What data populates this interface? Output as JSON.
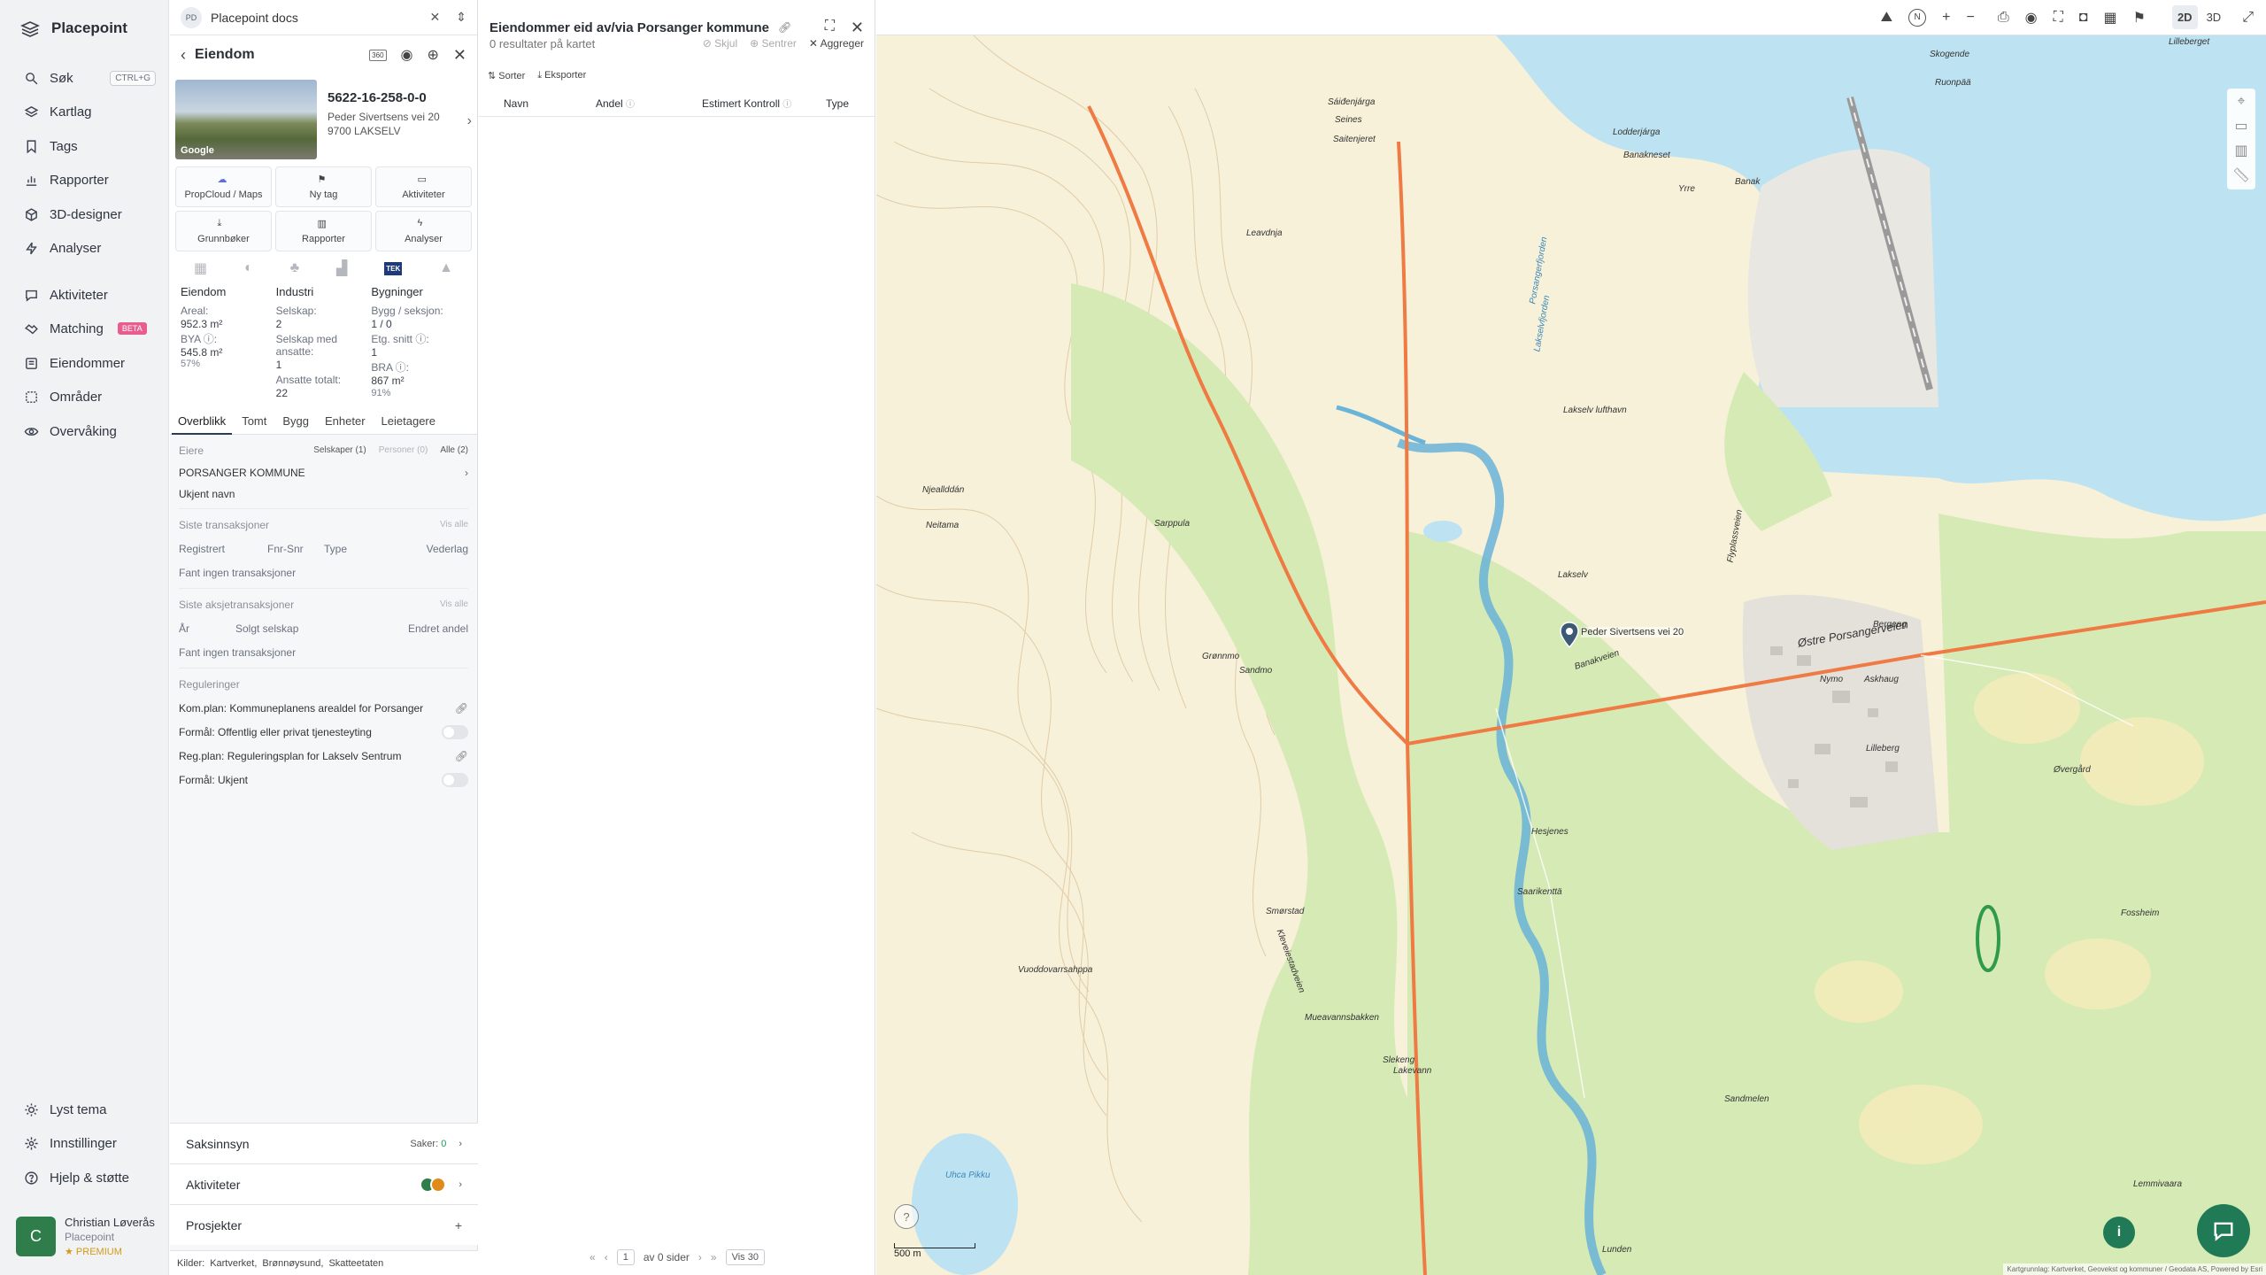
{
  "brand": "Placepoint",
  "nav": [
    {
      "label": "Søk",
      "icon": "search-icon",
      "shortcut": "CTRL+G"
    },
    {
      "label": "Kartlag",
      "icon": "layers-icon"
    },
    {
      "label": "Tags",
      "icon": "bookmark-icon"
    },
    {
      "label": "Rapporter",
      "icon": "bar-chart-icon"
    },
    {
      "label": "3D-designer",
      "icon": "cube-icon"
    },
    {
      "label": "Analyser",
      "icon": "lightning-icon"
    },
    {
      "label": "Aktiviteter",
      "icon": "chat-icon"
    },
    {
      "label": "Matching",
      "icon": "handshake-icon",
      "badge": "BETA"
    },
    {
      "label": "Eiendommer",
      "icon": "list-icon"
    },
    {
      "label": "Områder",
      "icon": "area-icon"
    },
    {
      "label": "Overvåking",
      "icon": "eye-icon"
    }
  ],
  "nav_bottom": [
    {
      "label": "Lyst tema",
      "icon": "sun-icon"
    },
    {
      "label": "Innstillinger",
      "icon": "gear-icon"
    },
    {
      "label": "Hjelp & støtte",
      "icon": "help-icon"
    }
  ],
  "user": {
    "initial": "C",
    "name": "Christian Løverås",
    "org": "Placepoint",
    "plan": "PREMIUM"
  },
  "docs": {
    "badge": "PD",
    "title": "Placepoint docs"
  },
  "property": {
    "header": "Eiendom",
    "id": "5622-16-258-0-0",
    "street": "Peder Sivertsens vei 20",
    "postal": "9700 LAKSELV",
    "streetview_label": "Google",
    "actions": [
      "PropCloud / Maps",
      "Ny tag",
      "Aktiviteter",
      "Grunnbøker",
      "Rapporter",
      "Analyser"
    ],
    "tek_label": "TEK",
    "stats": {
      "eiendom": {
        "title": "Eiendom",
        "areal_label": "Areal:",
        "areal": "952.3 m²",
        "bya_label": "BYA ⓘ:",
        "bya": "545.8 m²",
        "bya_pct": "57%"
      },
      "industri": {
        "title": "Industri",
        "selskap_label": "Selskap:",
        "selskap": "2",
        "ansatte_label": "Selskap med ansatte:",
        "ansatte": "1",
        "totalt_label": "Ansatte totalt:",
        "totalt": "22"
      },
      "bygninger": {
        "title": "Bygninger",
        "seksjon_label": "Bygg / seksjon:",
        "seksjon": "1 / 0",
        "etg_label": "Etg. snitt ⓘ:",
        "etg": "1",
        "bra_label": "BRA ⓘ:",
        "bra": "867 m²",
        "bra_pct": "91%"
      }
    },
    "tabs": [
      "Overblikk",
      "Tomt",
      "Bygg",
      "Enheter",
      "Leietagere"
    ],
    "owners": {
      "label": "Eiere",
      "pill_companies": "Selskaper (1)",
      "pill_persons": "Personer (0)",
      "pill_all": "Alle (2)",
      "rows": [
        "PORSANGER KOMMUNE",
        "Ukjent navn"
      ]
    },
    "transactions": {
      "title": "Siste transaksjoner",
      "see_all": "Vis alle",
      "cols": [
        "Registrert",
        "Fnr-Snr",
        "Type",
        "Vederlag"
      ],
      "empty": "Fant ingen transaksjoner"
    },
    "share_transactions": {
      "title": "Siste aksjetransaksjoner",
      "see_all": "Vis alle",
      "cols": [
        "År",
        "Solgt selskap",
        "Endret andel"
      ],
      "empty": "Fant ingen transaksjoner"
    },
    "regulations": {
      "title": "Reguleringer",
      "rows": [
        {
          "label": "Kom.plan: Kommuneplanens arealdel for Porsanger",
          "kind": "link"
        },
        {
          "label": "Formål: Offentlig eller privat tjenesteyting",
          "kind": "toggle"
        },
        {
          "label": "Reg.plan: Reguleringsplan for Lakselv Sentrum",
          "kind": "link"
        },
        {
          "label": "Formål: Ukjent",
          "kind": "toggle"
        }
      ]
    },
    "accordions": [
      {
        "label": "Saksinnsyn",
        "meta": "Saker:",
        "count": "0"
      },
      {
        "label": "Aktiviteter",
        "meta": ""
      },
      {
        "label": "Prosjekter",
        "meta": "+"
      }
    ],
    "sources": {
      "label": "Kilder:",
      "items": [
        "Kartverket,",
        "Brønnøysund,",
        "Skatteetaten"
      ]
    }
  },
  "list": {
    "title": "Eiendommer eid av/via Porsanger kommune",
    "results": "0 resultater på kartet",
    "actions": [
      "Skjul",
      "Sentrer",
      "Aggreger"
    ],
    "toolbar": [
      "Sorter",
      "Eksporter"
    ],
    "columns": [
      "Navn",
      "Andel",
      "Estimert Kontroll",
      "Type"
    ],
    "pager": {
      "page": "1",
      "of": "av 0 sider",
      "per_page": "Vis 30"
    }
  },
  "map": {
    "view_modes": [
      "2D",
      "3D"
    ],
    "active_mode": "2D",
    "scale": "500 m",
    "attribution": "Kartgrunnlag: Kartverket, Geovekst og kommuner / Geodata AS, Powered by Esri",
    "pin_label": "Peder Sivertsens vei 20",
    "labels": [
      "Skogende",
      "Lilleberget",
      "Ruonpää",
      "Sáiđenjárga",
      "Seines",
      "Saitenjeret",
      "Lodderjárga",
      "Banakneset",
      "Yrre",
      "Banak",
      "Lakselv lufthavn",
      "Lakselv",
      "Leavdnja",
      "Banakveien",
      "Østre Porsangerveien",
      "Flyplassveien",
      "Kleveiestadveien",
      "Njeallddán",
      "Neitama",
      "Sarppula",
      "Grønnmo",
      "Sandmo",
      "Smørstad",
      "Saarikenttä",
      "Hesjenes",
      "Porsangerfjorden",
      "Lakselvfjorden",
      "Vuoddovarrsahppa",
      "Uhca Pikku",
      "Mueavannsbakken",
      "Slekeng",
      "Lakevann",
      "Sandmelen",
      "Lunden",
      "Bergeng",
      "Nymo",
      "Askhaug",
      "Lilleberg",
      "Øvergård",
      "Fossheim",
      "Lemmivaara"
    ]
  },
  "colors": {
    "water": "#bde3f2",
    "forest": "#d6eab5",
    "field": "#f6f1d8",
    "road": "#ef7a43",
    "accent": "#1f7a55"
  }
}
